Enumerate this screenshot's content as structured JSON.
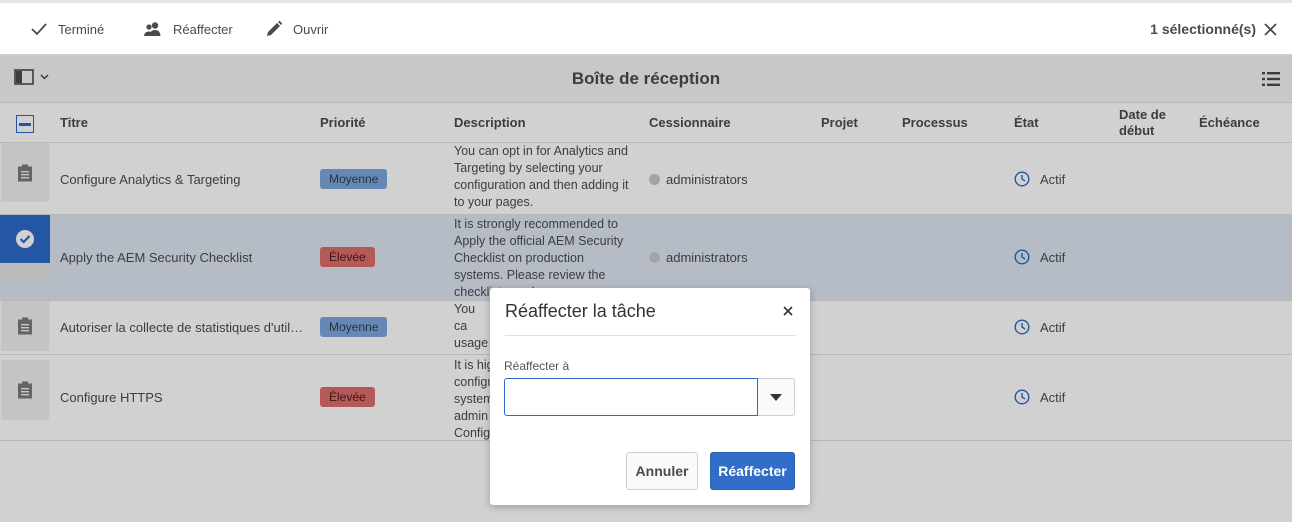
{
  "actionbar": {
    "done_label": "Terminé",
    "reassign_label": "Réaffecter",
    "open_label": "Ouvrir",
    "selection_count": "1 sélectionné(s)"
  },
  "titlebar": {
    "title": "Boîte de réception"
  },
  "table": {
    "columns": {
      "title": "Titre",
      "priority": "Priorité",
      "description": "Description",
      "assignee": "Cessionnaire",
      "project": "Projet",
      "workflow": "Processus",
      "state": "État",
      "start_date": "Date de début",
      "due": "Échéance"
    },
    "rows": [
      {
        "title": "Configure Analytics & Targeting",
        "priority": "Moyenne",
        "priority_level": "medium",
        "description": "You can opt in for Analytics and Targeting by selecting your configuration and then adding it to your pages.",
        "assignee": "administrators",
        "state": "Actif",
        "selected": false
      },
      {
        "title": "Apply the AEM Security Checklist",
        "priority": "Élevée",
        "priority_level": "high",
        "description": "It is strongly recommended to Apply the official AEM Security Checklist on production systems. Please review the checklist now by ope",
        "assignee": "administrators",
        "state": "Actif",
        "selected": true
      },
      {
        "title": "Autoriser la collecte de statistiques d'utilisati...",
        "priority": "Moyenne",
        "priority_level": "medium",
        "description": "You ca usage s enabli",
        "assignee": "",
        "state": "Actif",
        "selected": false
      },
      {
        "title": "Configure HTTPS",
        "priority": "Élevée",
        "priority_level": "high",
        "description": "It is hig configu system admin Configu",
        "assignee": "",
        "state": "Actif",
        "selected": false
      }
    ]
  },
  "dialog": {
    "title": "Réaffecter la tâche",
    "field_label": "Réaffecter à",
    "field_value": "",
    "field_placeholder": "",
    "cancel_label": "Annuler",
    "submit_label": "Réaffecter"
  },
  "colors": {
    "accent": "#326ec8",
    "priority_medium": "#7da7dc",
    "priority_high": "#dd6c6c",
    "selected_row": "#dde6f2"
  }
}
